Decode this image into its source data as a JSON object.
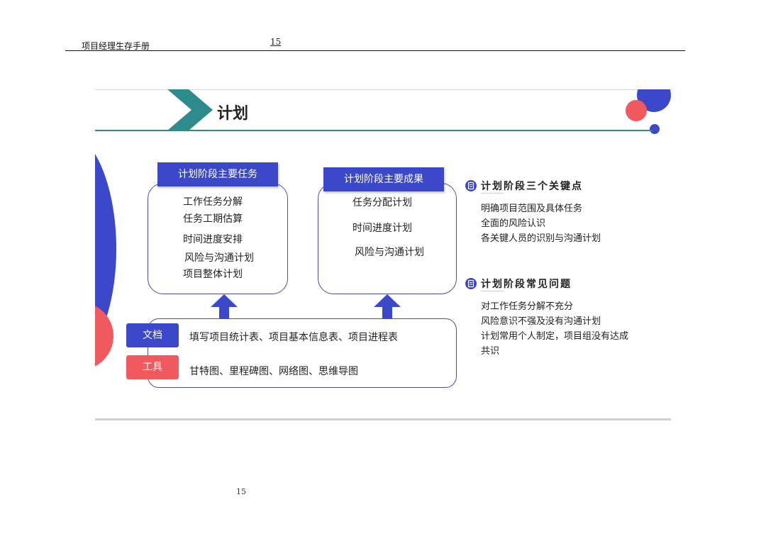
{
  "header": {
    "title": "项目经理生存手册",
    "page_number": "15"
  },
  "footer": {
    "page_number": "15"
  },
  "slide": {
    "title": "计划",
    "tasks_box": {
      "banner": "计划阶段主要任务",
      "items": [
        "工作任务分解",
        "任务工期估算",
        "时间进度安排",
        "风险与沟通计划",
        "项目整体计划"
      ]
    },
    "results_box": {
      "banner": "计划阶段主要成果",
      "items": [
        "任务分配计划",
        "时间进度计划",
        "风险与沟通计划"
      ]
    },
    "bottom": {
      "doc_label": "文档",
      "doc_text": "填写项目统计表、项目基本信息表、项目进程表",
      "tool_label": "工具",
      "tool_text": "甘特图、里程碑图、网络图、思维导图"
    },
    "key_points": {
      "heading": "计划阶段三个关键点",
      "lines": [
        "明确项目范围及具体任务",
        "全面的风险认识",
        "各关键人员的识别与沟通计划"
      ]
    },
    "common_issues": {
      "heading": "计划阶段常见问题",
      "lines": [
        "对工作任务分解不充分",
        "风险意识不强及没有沟通计划",
        "计划常用个人制定，项目组没有达成",
        "共识"
      ]
    },
    "colors": {
      "accent_blue": "#3a48c9",
      "accent_red": "#f05a5f",
      "teal": "#2e8b8b"
    }
  }
}
